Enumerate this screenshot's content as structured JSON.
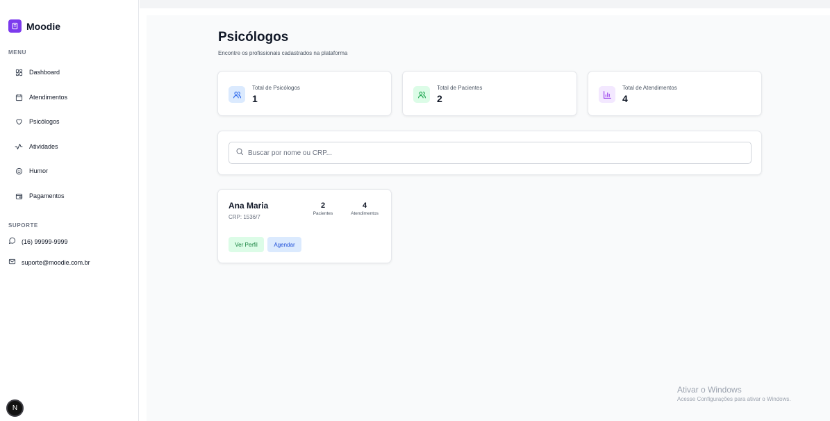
{
  "sidebar": {
    "brand": "Moodie",
    "menu_label": "MENU",
    "items": [
      {
        "label": "Dashboard",
        "icon": "grid-icon"
      },
      {
        "label": "Atendimentos",
        "icon": "calendar-icon"
      },
      {
        "label": "Psicólogos",
        "icon": "heart-icon"
      },
      {
        "label": "Atividades",
        "icon": "activity-icon"
      },
      {
        "label": "Humor",
        "icon": "smile-icon"
      },
      {
        "label": "Pagamentos",
        "icon": "wallet-icon"
      }
    ],
    "support_label": "SUPORTE",
    "support": {
      "phone": "(16) 99999-9999",
      "email": "suporte@moodie.com.br"
    },
    "avatar_letter": "N"
  },
  "header": {
    "title": "Psicólogos",
    "subtitle": "Encontre os profissionais cadastrados na plataforma"
  },
  "stats": [
    {
      "label": "Total de Psicólogos",
      "value": "1",
      "icon": "users-icon",
      "color": "#2563eb",
      "bg": "#dbeafe"
    },
    {
      "label": "Total de Pacientes",
      "value": "2",
      "icon": "users-icon",
      "color": "#16a34a",
      "bg": "#dcfce7"
    },
    {
      "label": "Total de Atendimentos",
      "value": "4",
      "icon": "bar-chart-icon",
      "color": "#9333ea",
      "bg": "#f3e8ff"
    }
  ],
  "search": {
    "placeholder": "Buscar por nome ou CRP...",
    "value": ""
  },
  "psychologists": [
    {
      "name": "Ana Maria",
      "crp": "CRP: 1536/7",
      "patients": "2",
      "patients_label": "Pacientes",
      "appointments": "4",
      "appointments_label": "Atendimentos",
      "view_label": "Ver Perfil",
      "schedule_label": "Agendar"
    }
  ],
  "watermark": {
    "title": "Ativar o Windows",
    "subtitle": "Acesse Configurações para ativar o Windows."
  }
}
